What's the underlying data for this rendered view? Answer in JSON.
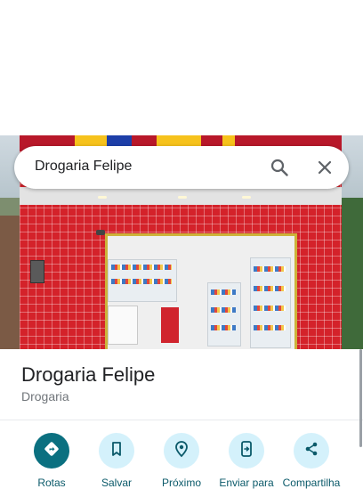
{
  "search": {
    "query": "Drogaria Felipe"
  },
  "place": {
    "title": "Drogaria Felipe",
    "category": "Drogaria"
  },
  "actions": [
    {
      "label": "Rotas",
      "icon": "directions-icon"
    },
    {
      "label": "Salvar",
      "icon": "bookmark-icon"
    },
    {
      "label": "Próximo",
      "icon": "nearby-icon"
    },
    {
      "label": "Enviar para",
      "icon": "send-to-phone-icon"
    },
    {
      "label": "Compartilha",
      "icon": "share-icon"
    }
  ],
  "colors": {
    "primary_action": "#0b7080",
    "secondary_action_bg": "#d4f1fb",
    "storefront": "#d4222a"
  }
}
